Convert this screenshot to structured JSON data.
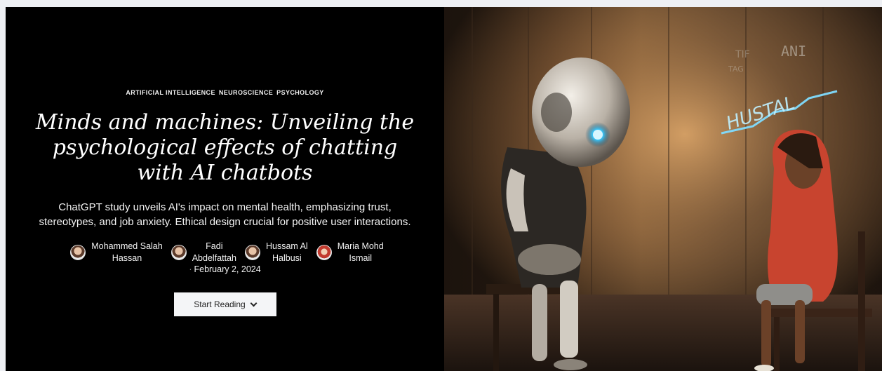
{
  "hero": {
    "topics": [
      "ARTIFICIAL INTELLIGENCE",
      "NEUROSCIENCE",
      "PSYCHOLOGY"
    ],
    "title": "Minds and machines: Unveiling the psychological effects of chatting with AI chatbots",
    "summary": "ChatGPT study unveils AI's impact on mental health, emphasizing trust, stereotypes, and job anxiety. Ethical design crucial for positive user interactions.",
    "authors": [
      {
        "line1": "Mohammed Salah",
        "line2": "Hassan"
      },
      {
        "line1": "Fadi",
        "line2": "Abdelfattah"
      },
      {
        "line1": "Hussam Al",
        "line2": "Halbusi"
      },
      {
        "line1": "Maria Mohd",
        "line2": "Ismail"
      }
    ],
    "date_separator": "·",
    "date": "February 2, 2024",
    "cta_label": "Start Reading",
    "cta_icon": "chevron-down-icon"
  },
  "image": {
    "neon_text": "HUSTAL",
    "wall_graffiti": [
      "ANI",
      "TIF",
      "TAG"
    ]
  }
}
